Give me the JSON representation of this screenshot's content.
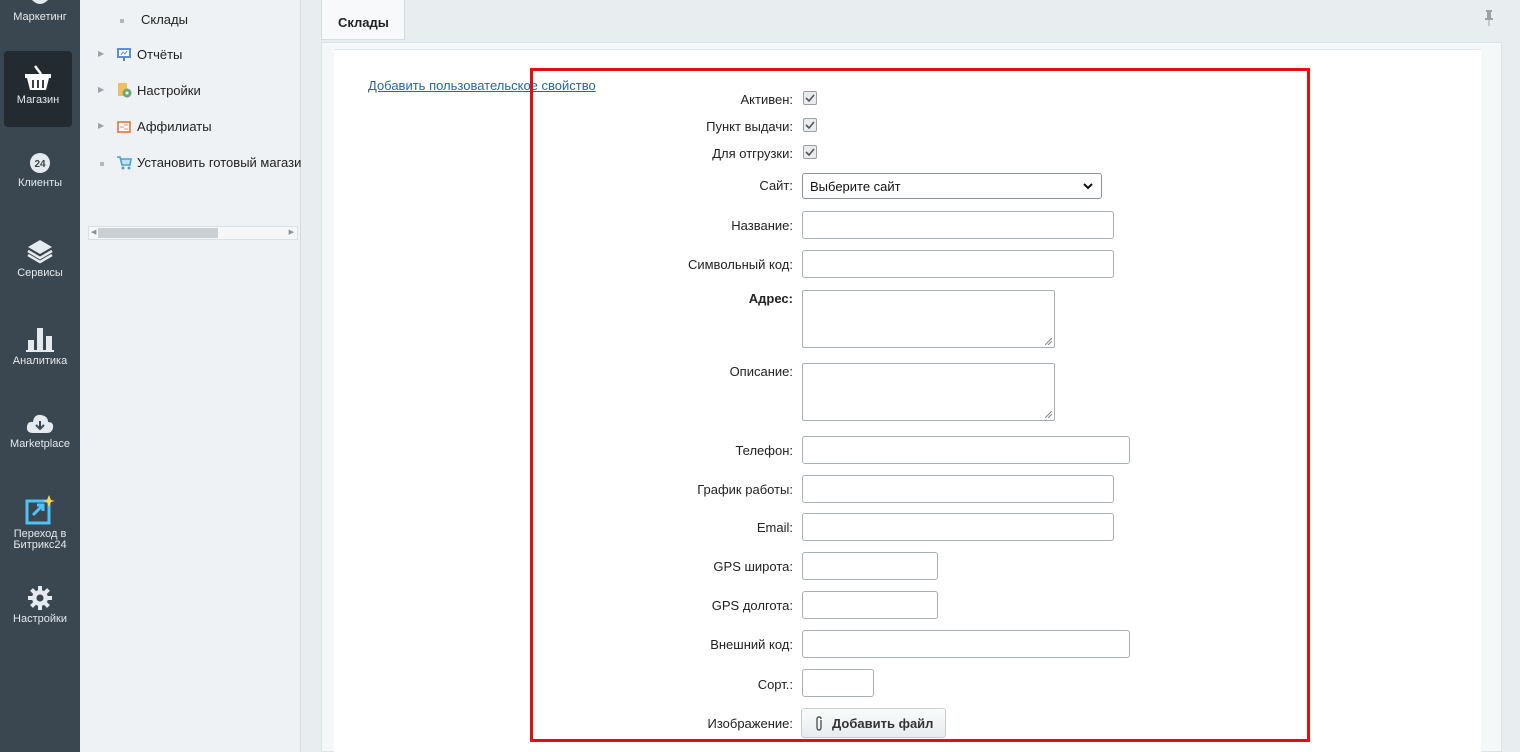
{
  "rail": {
    "items": [
      {
        "label": "Маркетинг",
        "icon": "marketing-icon"
      },
      {
        "label": "Магазин",
        "icon": "basket-icon"
      },
      {
        "label": "Клиенты",
        "icon": "clients-24-icon"
      },
      {
        "label": "Сервисы",
        "icon": "layers-icon"
      },
      {
        "label": "Аналитика",
        "icon": "bar-chart-icon"
      },
      {
        "label": "Marketplace",
        "icon": "cloud-download-icon"
      },
      {
        "label": "Переход в",
        "label2": "Битрикс24",
        "icon": "bitrix24-icon"
      },
      {
        "label": "Настройки",
        "icon": "gear-icon"
      }
    ]
  },
  "submenu": {
    "items": [
      {
        "label": "Склады"
      },
      {
        "label": "Отчёты"
      },
      {
        "label": "Настройки"
      },
      {
        "label": "Аффилиаты"
      },
      {
        "label": "Установить готовый магазин"
      }
    ]
  },
  "tab": {
    "label": "Склады"
  },
  "add_property_link": "Добавить пользовательское свойство",
  "form": {
    "active_label": "Активен:",
    "pickup_label": "Пункт выдачи:",
    "shipping_label": "Для отгрузки:",
    "site_label": "Сайт:",
    "site_value": "Выберите сайт",
    "name_label": "Название:",
    "code_label": "Символьный код:",
    "address_label": "Адрес:",
    "description_label": "Описание:",
    "phone_label": "Телефон:",
    "schedule_label": "График работы:",
    "email_label": "Email:",
    "gps_lat_label": "GPS широта:",
    "gps_lon_label": "GPS долгота:",
    "external_code_label": "Внешний код:",
    "sort_label": "Сорт.:",
    "image_label": "Изображение:",
    "add_file_label": "Добавить файл"
  },
  "colors": {
    "accent": "#2067b0",
    "highlight": "#e01010",
    "rail": "#3a4650"
  }
}
